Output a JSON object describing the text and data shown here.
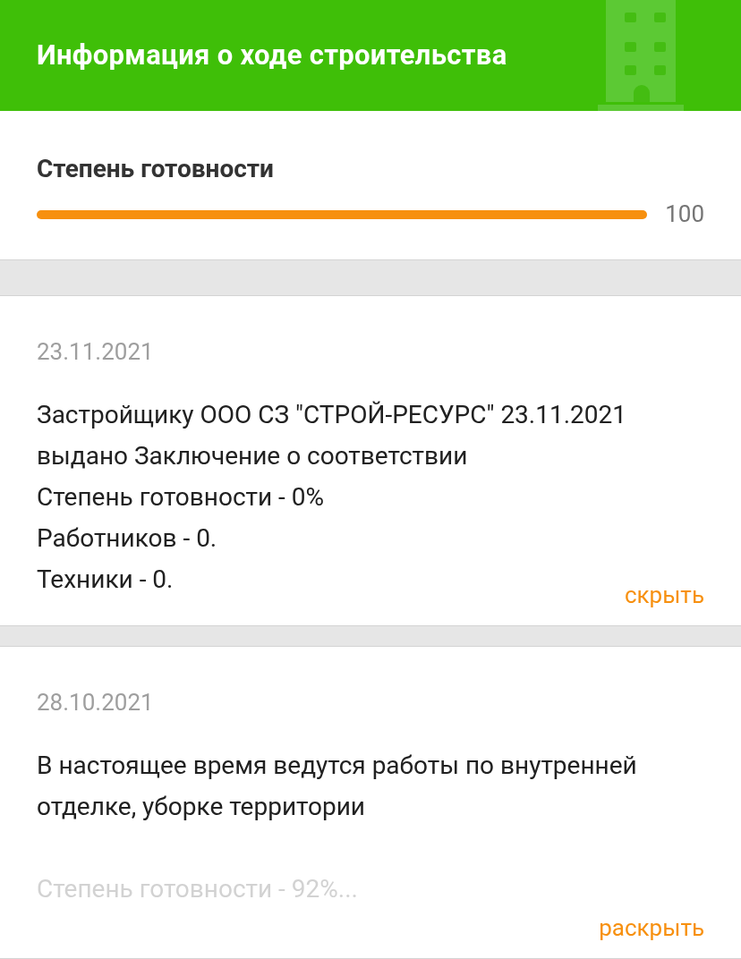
{
  "header": {
    "title": "Информация о ходе строительства"
  },
  "readiness": {
    "title": "Степень готовности",
    "level": 1.0,
    "reading": "100"
  },
  "entries": [
    {
      "date": "23.11.2021",
      "lines": [
        "Застройщику ООО СЗ \"СТРОЙ-РЕСУРС\" 23.11.2021 выдано Заключение о соответствии",
        "Степень готовности - 0%",
        "Работников - 0.",
        "Техники - 0."
      ],
      "expanded": true,
      "toggle": "скрыть"
    },
    {
      "date": "28.10.2021",
      "lines": [
        "В настоящее время ведутся работы по внутренней отделке, уборке территории"
      ],
      "preview": "Степень готовности - 92%...",
      "expanded": false,
      "toggle": "раскрыть"
    }
  ]
}
